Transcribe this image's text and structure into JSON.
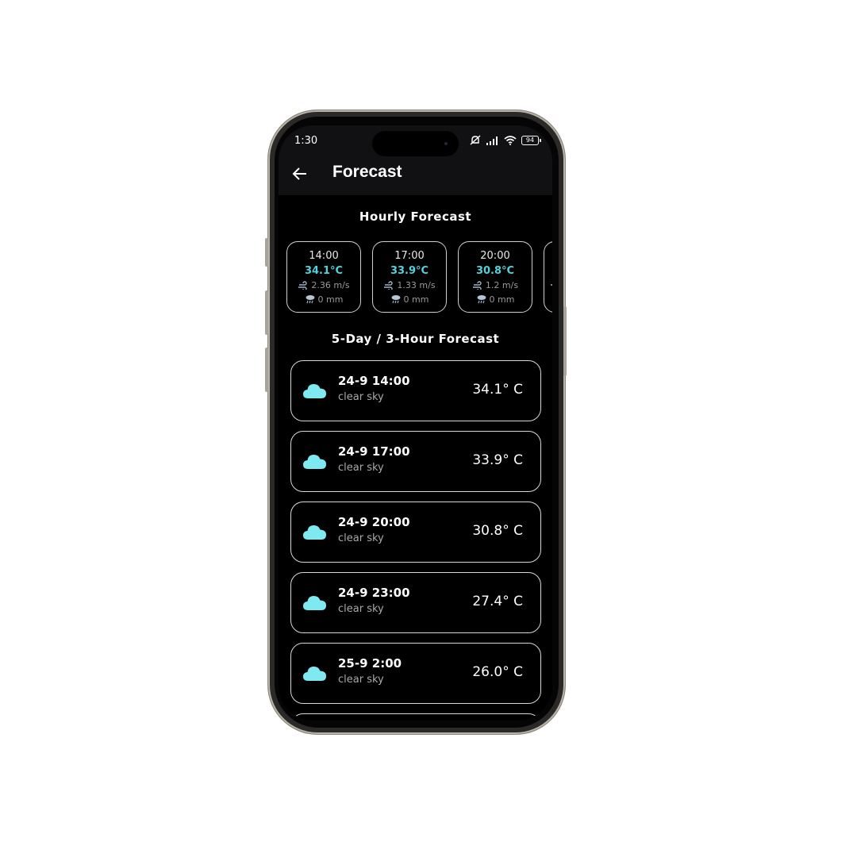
{
  "status_bar": {
    "time": "1:30",
    "battery": "94"
  },
  "app_bar": {
    "title": "Forecast"
  },
  "hourly": {
    "title": "Hourly Forecast",
    "items": [
      {
        "time": "14:00",
        "temp": "34.1°C",
        "wind": "2.36 m/s",
        "rain": "0 mm"
      },
      {
        "time": "17:00",
        "temp": "33.9°C",
        "wind": "1.33 m/s",
        "rain": "0 mm"
      },
      {
        "time": "20:00",
        "temp": "30.8°C",
        "wind": "1.2 m/s",
        "rain": "0 mm"
      }
    ]
  },
  "five_day": {
    "title": "5-Day / 3-Hour Forecast",
    "items": [
      {
        "datetime": "24-9 14:00",
        "description": "clear sky",
        "temp": "34.1° C"
      },
      {
        "datetime": "24-9 17:00",
        "description": "clear sky",
        "temp": "33.9° C"
      },
      {
        "datetime": "24-9 20:00",
        "description": "clear sky",
        "temp": "30.8° C"
      },
      {
        "datetime": "24-9 23:00",
        "description": "clear sky",
        "temp": "27.4° C"
      },
      {
        "datetime": "25-9 2:00",
        "description": "clear sky",
        "temp": "26.0° C"
      }
    ]
  },
  "colors": {
    "accent": "#4fd3dd",
    "cloud": "#7fe9f2",
    "background": "#000000"
  }
}
